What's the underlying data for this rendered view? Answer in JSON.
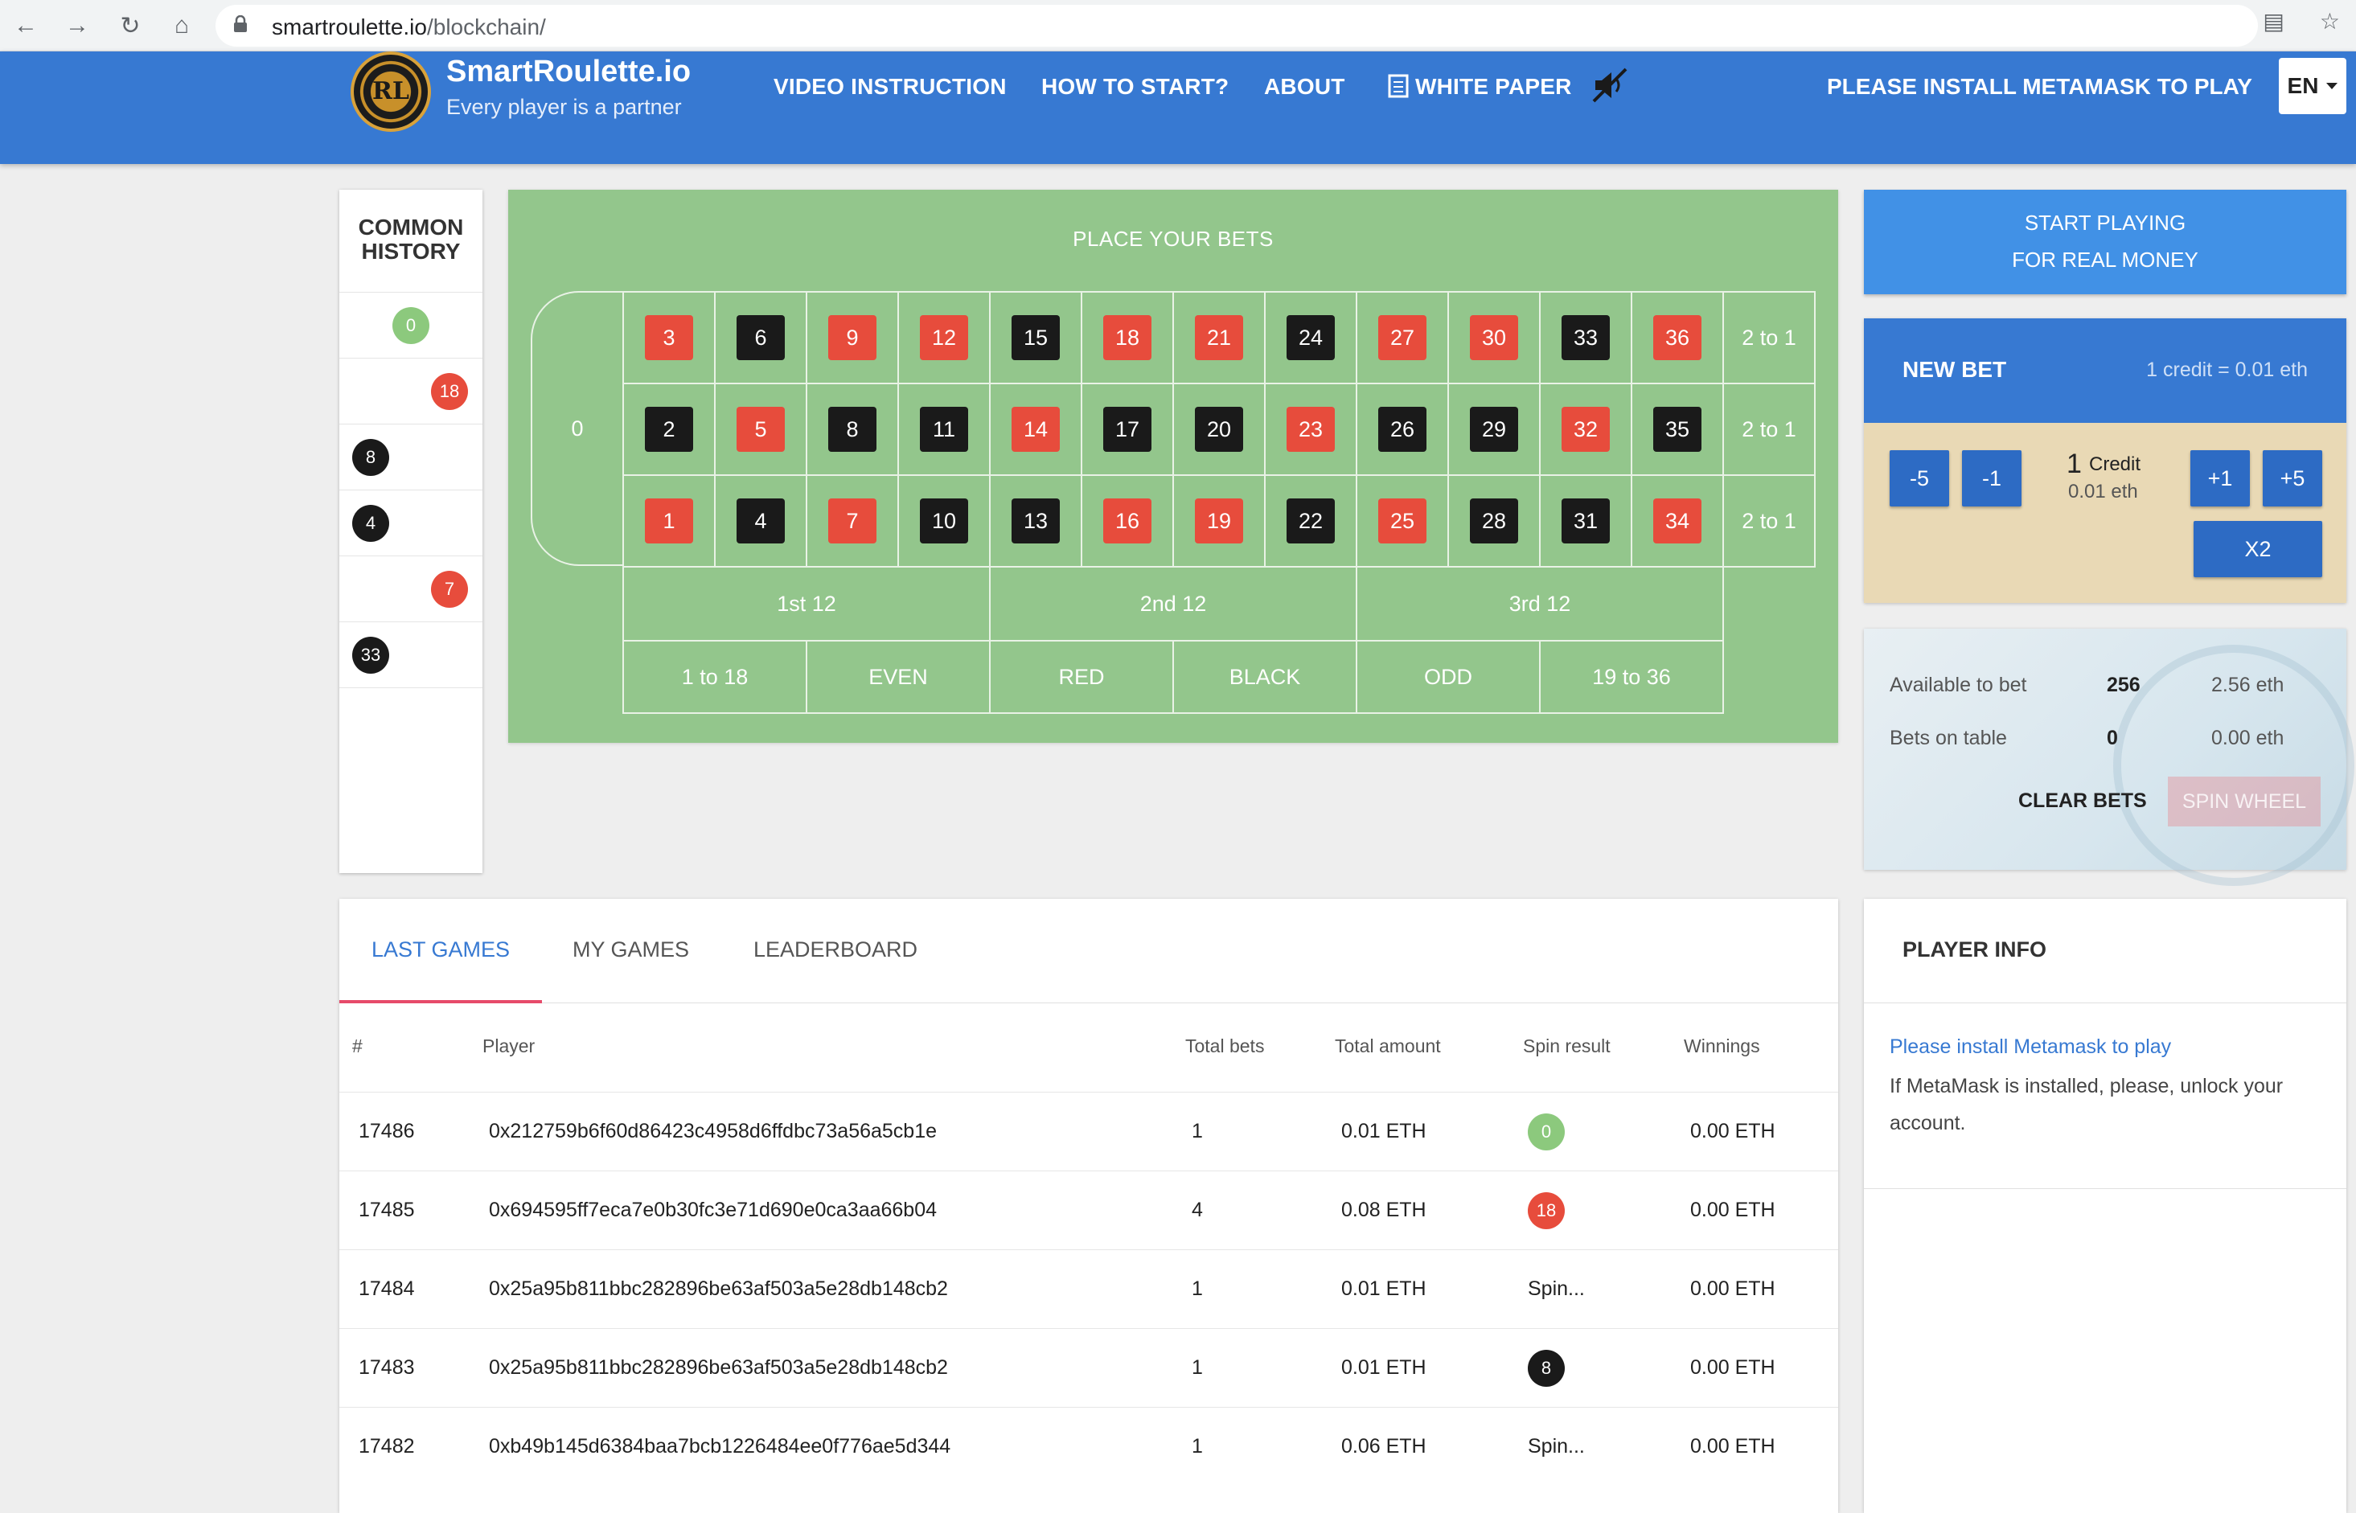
{
  "browser": {
    "url_host": "smartroulette.io",
    "url_path": "/blockchain/"
  },
  "header": {
    "logo_text": "RL",
    "brand": "SmartRoulette.io",
    "tagline": "Every player is a partner",
    "nav": [
      "VIDEO INSTRUCTION",
      "HOW TO START?",
      "ABOUT",
      "WHITE PAPER"
    ],
    "metamask": "PLEASE INSTALL METAMASK TO PLAY",
    "lang": "EN"
  },
  "history": {
    "title_line1": "COMMON",
    "title_line2": "HISTORY",
    "items": [
      {
        "n": "0",
        "color": "green"
      },
      {
        "n": "18",
        "color": "red"
      },
      {
        "n": "8",
        "color": "black"
      },
      {
        "n": "4",
        "color": "black"
      },
      {
        "n": "7",
        "color": "red"
      },
      {
        "n": "33",
        "color": "black"
      }
    ]
  },
  "board": {
    "title": "PLACE YOUR BETS",
    "zero": "0",
    "rows": [
      [
        {
          "n": "3",
          "c": "red"
        },
        {
          "n": "6",
          "c": "black"
        },
        {
          "n": "9",
          "c": "red"
        },
        {
          "n": "12",
          "c": "red"
        },
        {
          "n": "15",
          "c": "black"
        },
        {
          "n": "18",
          "c": "red"
        },
        {
          "n": "21",
          "c": "red"
        },
        {
          "n": "24",
          "c": "black"
        },
        {
          "n": "27",
          "c": "red"
        },
        {
          "n": "30",
          "c": "red"
        },
        {
          "n": "33",
          "c": "black"
        },
        {
          "n": "36",
          "c": "red"
        }
      ],
      [
        {
          "n": "2",
          "c": "black"
        },
        {
          "n": "5",
          "c": "red"
        },
        {
          "n": "8",
          "c": "black"
        },
        {
          "n": "11",
          "c": "black"
        },
        {
          "n": "14",
          "c": "red"
        },
        {
          "n": "17",
          "c": "black"
        },
        {
          "n": "20",
          "c": "black"
        },
        {
          "n": "23",
          "c": "red"
        },
        {
          "n": "26",
          "c": "black"
        },
        {
          "n": "29",
          "c": "black"
        },
        {
          "n": "32",
          "c": "red"
        },
        {
          "n": "35",
          "c": "black"
        }
      ],
      [
        {
          "n": "1",
          "c": "red"
        },
        {
          "n": "4",
          "c": "black"
        },
        {
          "n": "7",
          "c": "red"
        },
        {
          "n": "10",
          "c": "black"
        },
        {
          "n": "13",
          "c": "black"
        },
        {
          "n": "16",
          "c": "red"
        },
        {
          "n": "19",
          "c": "red"
        },
        {
          "n": "22",
          "c": "black"
        },
        {
          "n": "25",
          "c": "red"
        },
        {
          "n": "28",
          "c": "black"
        },
        {
          "n": "31",
          "c": "black"
        },
        {
          "n": "34",
          "c": "red"
        }
      ]
    ],
    "columns": [
      "2 to 1",
      "2 to 1",
      "2 to 1"
    ],
    "dozens": [
      "1st 12",
      "2nd 12",
      "3rd 12"
    ],
    "outside": [
      "1 to 18",
      "EVEN",
      "RED",
      "BLACK",
      "ODD",
      "19 to 36"
    ]
  },
  "controls": {
    "start_line1": "START PLAYING",
    "start_line2": "FOR REAL MONEY",
    "new_bet": "NEW BET",
    "rate": "1 credit = 0.01 eth",
    "minus5": "-5",
    "minus1": "-1",
    "plus1": "+1",
    "plus5": "+5",
    "x2": "X2",
    "credit_value": "1",
    "credit_label": "Credit",
    "credit_eth": "0.01 eth",
    "available_label": "Available to bet",
    "available_value": "256",
    "available_eth": "2.56 eth",
    "bets_label": "Bets on table",
    "bets_value": "0",
    "bets_eth": "0.00 eth",
    "clear": "CLEAR BETS",
    "spin": "SPIN WHEEL"
  },
  "games": {
    "tabs": [
      "LAST GAMES",
      "MY GAMES",
      "LEADERBOARD"
    ],
    "columns": [
      "#",
      "Player",
      "Total bets",
      "Total amount",
      "Spin result",
      "Winnings"
    ],
    "rows": [
      {
        "id": "17486",
        "player": "0x212759b6f60d86423c4958d6ffdbc73a56a5cb1e",
        "bets": "1",
        "amount": "0.01 ETH",
        "result": "0",
        "result_color": "green",
        "win": "0.00 ETH"
      },
      {
        "id": "17485",
        "player": "0x694595ff7eca7e0b30fc3e71d690e0ca3aa66b04",
        "bets": "4",
        "amount": "0.08 ETH",
        "result": "18",
        "result_color": "red",
        "win": "0.00 ETH"
      },
      {
        "id": "17484",
        "player": "0x25a95b811bbc282896be63af503a5e28db148cb2",
        "bets": "1",
        "amount": "0.01 ETH",
        "result": "Spin...",
        "result_color": "",
        "win": "0.00 ETH"
      },
      {
        "id": "17483",
        "player": "0x25a95b811bbc282896be63af503a5e28db148cb2",
        "bets": "1",
        "amount": "0.01 ETH",
        "result": "8",
        "result_color": "black",
        "win": "0.00 ETH"
      },
      {
        "id": "17482",
        "player": "0xb49b145d6384baa7bcb1226484ee0f776ae5d344",
        "bets": "1",
        "amount": "0.06 ETH",
        "result": "Spin...",
        "result_color": "",
        "win": "0.00 ETH"
      }
    ]
  },
  "player_info": {
    "title": "PLAYER INFO",
    "link": "Please install Metamask to play",
    "message": "If MetaMask is installed, please, unlock your account."
  },
  "colors": {
    "header_blue": "#3779d2",
    "table_green": "#93c68c",
    "red": "#e74c3c",
    "black": "#1a1a1a",
    "chip_green": "#8cc97d",
    "tab_underline": "#e64a6a"
  }
}
